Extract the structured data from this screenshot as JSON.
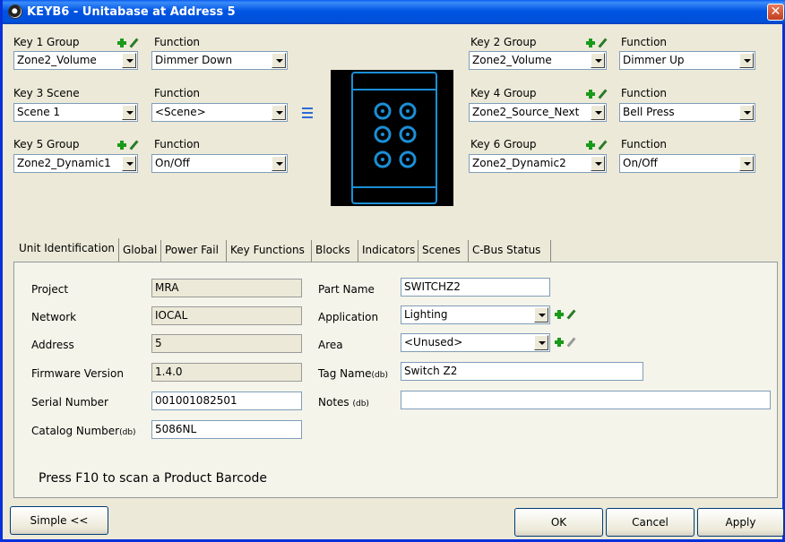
{
  "window": {
    "title": "KEYB6 - Unitabase at Address 5"
  },
  "keys": [
    {
      "label": "Key 1 Group",
      "value": "Zone2_Volume",
      "function_label": "Function",
      "function": "Dimmer Down"
    },
    {
      "label": "Key 2 Group",
      "value": "Zone2_Volume",
      "function_label": "Function",
      "function": "Dimmer Up"
    },
    {
      "label": "Key 3 Scene",
      "value": "Scene 1",
      "function_label": "Function",
      "function": "<Scene>"
    },
    {
      "label": "Key 4 Group",
      "value": "Zone2_Source_Next",
      "function_label": "Function",
      "function": "Bell Press"
    },
    {
      "label": "Key 5 Group",
      "value": "Zone2_Dynamic1",
      "function_label": "Function",
      "function": "On/Off"
    },
    {
      "label": "Key 6 Group",
      "value": "Zone2_Dynamic2",
      "function_label": "Function",
      "function": "On/Off"
    }
  ],
  "tabs": [
    "Unit Identification",
    "Global",
    "Power Fail",
    "Key Functions",
    "Blocks",
    "Indicators",
    "Scenes",
    "C-Bus Status"
  ],
  "unit": {
    "project_label": "Project",
    "project": "MRA",
    "network_label": "Network",
    "network": "IOCAL",
    "address_label": "Address",
    "address": "5",
    "firmware_label": "Firmware Version",
    "firmware": "1.4.0",
    "serial_label": "Serial Number",
    "serial": "001001082501",
    "catalog_label": "Catalog Number",
    "catalog_suffix": "(db)",
    "catalog": "5086NL",
    "part_label": "Part Name",
    "part": "SWITCHZ2",
    "application_label": "Application",
    "application": "Lighting",
    "area_label": "Area",
    "area": "<Unused>",
    "tag_label": "Tag Name",
    "tag_suffix": "(db)",
    "tag": "Switch Z2",
    "notes_label": "Notes",
    "notes_suffix": "(db)",
    "notes": ""
  },
  "hint": "Press F10 to scan a Product Barcode",
  "buttons": {
    "simple": "Simple <<",
    "ok": "OK",
    "cancel": "Cancel",
    "apply": "Apply"
  },
  "colors": {
    "title_blue": "#0054e3",
    "panel_led": "#1a8fd6",
    "panel_bg": "#000000"
  }
}
